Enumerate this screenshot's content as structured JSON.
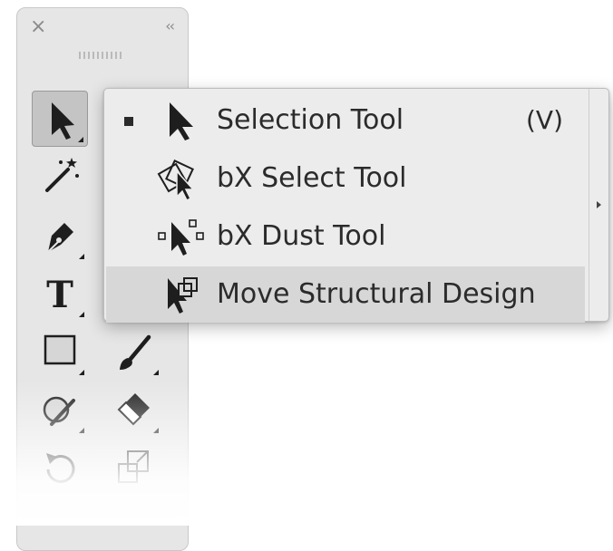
{
  "panel": {
    "close_icon": "close-icon",
    "collapse_icon": "collapse-double-chevron-icon",
    "grip_icon": "panel-grip-icon",
    "tools": [
      {
        "name": "selection-tool",
        "icon": "selection-arrow-icon",
        "active": true
      },
      {
        "name": "magic-wand-tool",
        "icon": "magic-wand-icon",
        "active": false
      },
      {
        "name": "pen-tool",
        "icon": "pen-nib-icon",
        "active": false
      },
      {
        "name": "type-tool",
        "icon": "type-T-icon",
        "active": false
      },
      {
        "name": "rectangle-tool",
        "icon": "rectangle-icon",
        "active": false
      },
      {
        "name": "paintbrush-tool",
        "icon": "paintbrush-icon",
        "active": false
      },
      {
        "name": "shaper-tool",
        "icon": "shaper-icon",
        "active": false
      },
      {
        "name": "eraser-tool",
        "icon": "eraser-icon",
        "active": false
      },
      {
        "name": "rotate-tool",
        "icon": "rotate-icon",
        "active": false
      },
      {
        "name": "scale-tool",
        "icon": "scale-icon",
        "active": false
      }
    ]
  },
  "flyout": {
    "items": [
      {
        "label": "Selection Tool",
        "shortcut": "(V)",
        "icon": "selection-arrow-icon",
        "current": true,
        "highlighted": false
      },
      {
        "label": "bX Select Tool",
        "shortcut": "",
        "icon": "bx-select-icon",
        "current": false,
        "highlighted": false
      },
      {
        "label": "bX Dust Tool",
        "shortcut": "",
        "icon": "bx-dust-icon",
        "current": false,
        "highlighted": false
      },
      {
        "label": "Move Structural Design",
        "shortcut": "",
        "icon": "move-structural-design-icon",
        "current": false,
        "highlighted": true
      }
    ],
    "tearoff_icon": "tearoff-arrow-icon"
  },
  "colors": {
    "panel_bg": "#e6e6e6",
    "menu_bg": "#ececec",
    "highlight_bg": "#d7d7d7",
    "active_tool_bg": "#c4c4c4",
    "icon_dark": "#1e1e1e"
  }
}
